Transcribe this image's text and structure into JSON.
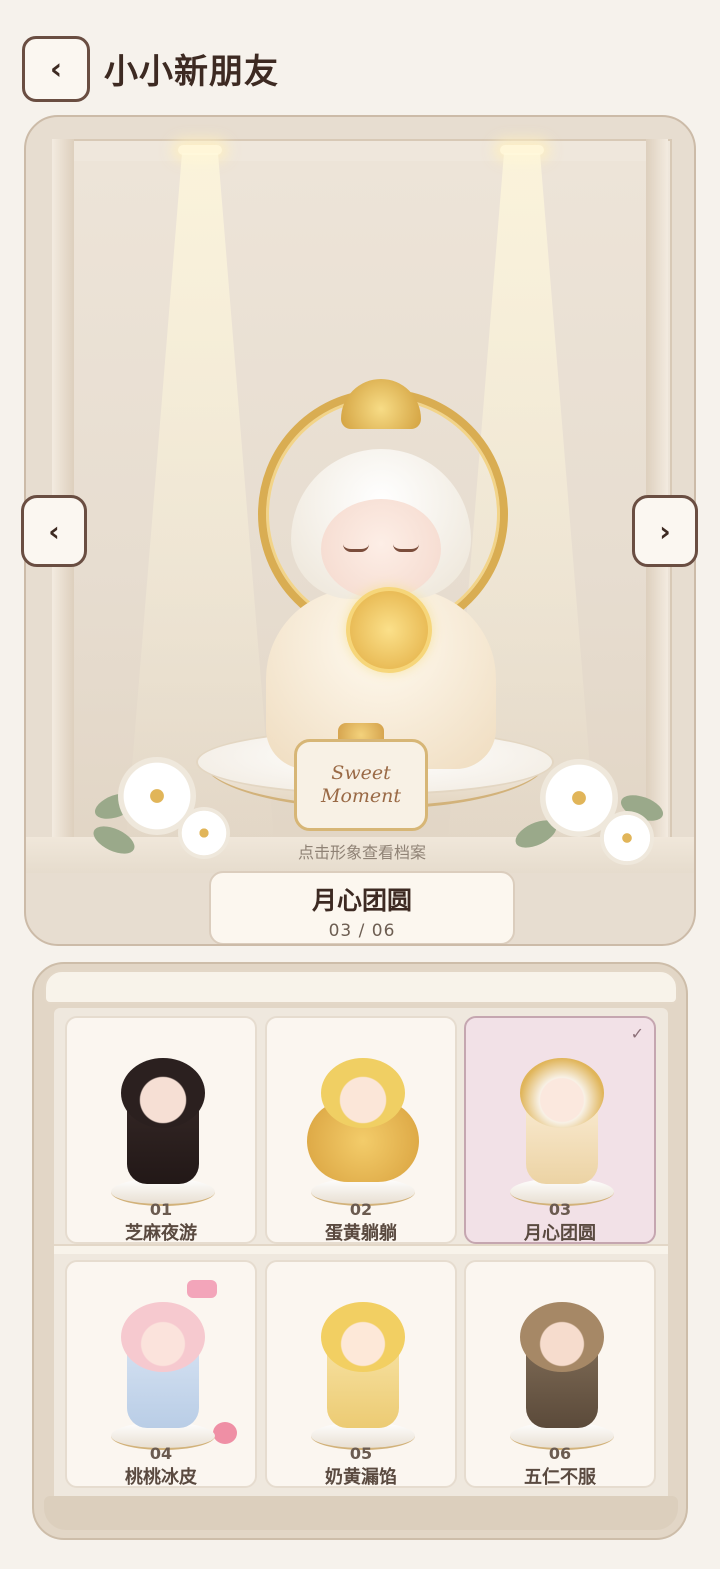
{
  "header": {
    "back_label": "‹",
    "title": "小小新朋友"
  },
  "showcase": {
    "plaque_line1": "Sweet",
    "plaque_line2": "Moment",
    "hint": "点击形象查看档案",
    "current_name": "月心团圆",
    "current_index": "03 / 06",
    "prev_label": "‹",
    "next_label": "›"
  },
  "collection": {
    "selected_mark": "✓",
    "items": [
      {
        "number": "01",
        "name": "芝麻夜游",
        "selected": false
      },
      {
        "number": "02",
        "name": "蛋黄躺躺",
        "selected": false
      },
      {
        "number": "03",
        "name": "月心团圆",
        "selected": true
      },
      {
        "number": "04",
        "name": "桃桃冰皮",
        "selected": false
      },
      {
        "number": "05",
        "name": "奶黄漏馅",
        "selected": false
      },
      {
        "number": "06",
        "name": "五仁不服",
        "selected": false
      }
    ]
  },
  "colors": {
    "background": "#f6f2ec",
    "selected_card": "#f2e1e7",
    "accent_gold": "#d9ad52",
    "button_border": "#6a4e42"
  }
}
